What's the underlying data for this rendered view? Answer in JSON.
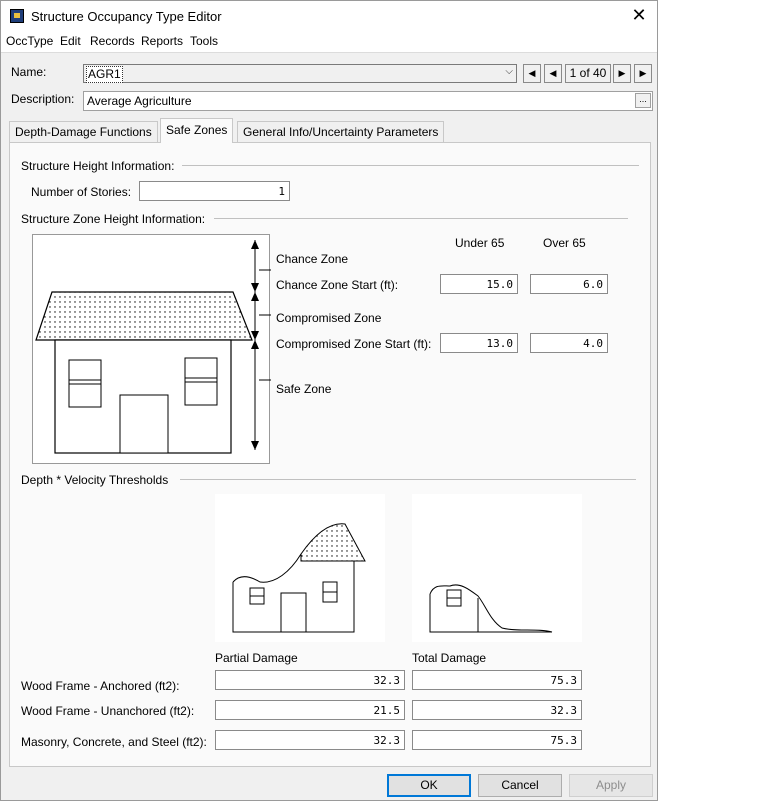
{
  "window": {
    "title": "Structure Occupancy Type Editor",
    "close_glyph": "✕"
  },
  "menu": [
    "OccType",
    "Edit",
    "Records",
    "Reports",
    "Tools"
  ],
  "header": {
    "name_label": "Name:",
    "name_value": "AGR1",
    "description_label": "Description:",
    "description_value": "Average Agriculture",
    "ellipsis": "...",
    "record_counter": "1 of 40",
    "nav_icons": [
      "first-record-icon",
      "previous-record-icon",
      "next-record-icon",
      "last-record-icon"
    ]
  },
  "tabs": [
    {
      "label": "Depth-Damage Functions",
      "active": false
    },
    {
      "label": "Safe Zones",
      "active": true
    },
    {
      "label": "General Info/Uncertainty Parameters",
      "active": false
    }
  ],
  "height_info": {
    "heading": "Structure Height Information:",
    "stories_label": "Number of Stories:",
    "stories_value": "1"
  },
  "zone_info": {
    "heading": "Structure Zone Height Information:",
    "under_label": "Under 65",
    "over_label": "Over 65",
    "chance_zone_label": "Chance Zone",
    "chance_start_label": "Chance Zone Start (ft):",
    "chance_under": "15.0",
    "chance_over": "6.0",
    "compromised_zone_label": "Compromised Zone",
    "compromised_start_label": "Compromised Zone Start (ft):",
    "compromised_under": "13.0",
    "compromised_over": "4.0",
    "safe_zone_label": "Safe Zone"
  },
  "thresholds": {
    "heading": "Depth * Velocity Thresholds",
    "partial_label": "Partial Damage",
    "total_label": "Total Damage",
    "rows": [
      {
        "label": "Wood Frame - Anchored (ft2):",
        "partial": "32.3",
        "total": "75.3"
      },
      {
        "label": "Wood Frame - Unanchored (ft2):",
        "partial": "21.5",
        "total": "32.3"
      },
      {
        "label": "Masonry, Concrete, and Steel (ft2):",
        "partial": "32.3",
        "total": "75.3"
      }
    ]
  },
  "buttons": {
    "ok": "OK",
    "cancel": "Cancel",
    "apply": "Apply"
  },
  "colors": {
    "accent": "#0078d7",
    "window_bg": "#f0f0f0",
    "panel_bg": "#fafafa"
  }
}
